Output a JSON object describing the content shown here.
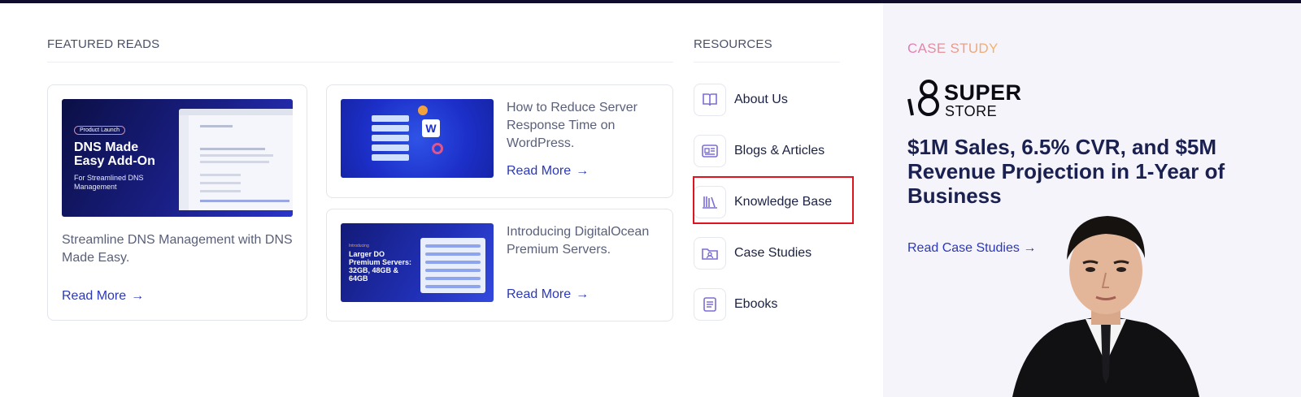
{
  "featured": {
    "heading": "FEATURED READS",
    "big_card": {
      "image": {
        "pill": "Product Launch",
        "headline_1": "DNS Made",
        "headline_2": "Easy Add-On",
        "subline_1": "For Streamlined DNS",
        "subline_2": "Management"
      },
      "description": "Streamline DNS Management with DNS Made Easy.",
      "link": "Read More"
    },
    "cards": [
      {
        "title": "How to Reduce Server Response Time on WordPress.",
        "link": "Read More"
      },
      {
        "title": "Introducing DigitalOcean Premium Servers.",
        "link": "Read More",
        "image_tag": "Introducing",
        "image_text_1": "Larger DO",
        "image_text_2": "Premium Servers:",
        "image_text_3": "32GB, 48GB &",
        "image_text_4": "64GB"
      }
    ]
  },
  "resources": {
    "heading": "RESOURCES",
    "items": [
      {
        "label": "About Us",
        "icon": "book-open-icon"
      },
      {
        "label": "Blogs & Articles",
        "icon": "newspaper-icon"
      },
      {
        "label": "Knowledge Base",
        "icon": "library-icon"
      },
      {
        "label": "Case Studies",
        "icon": "folder-user-icon"
      },
      {
        "label": "Ebooks",
        "icon": "document-icon"
      }
    ],
    "highlighted_index": 2
  },
  "case_study": {
    "label": "CASE STUDY",
    "logo_top": "SUPER",
    "logo_bottom": "STORE",
    "title": "$1M Sales, 6.5% CVR, and $5M Revenue Projection in 1-Year of Business",
    "link": "Read Case Studies"
  },
  "colors": {
    "accent": "#2b38b8",
    "highlight_border": "#e0141e",
    "topbar": "#0f0c2e",
    "case_bg": "#f6f4fb"
  }
}
